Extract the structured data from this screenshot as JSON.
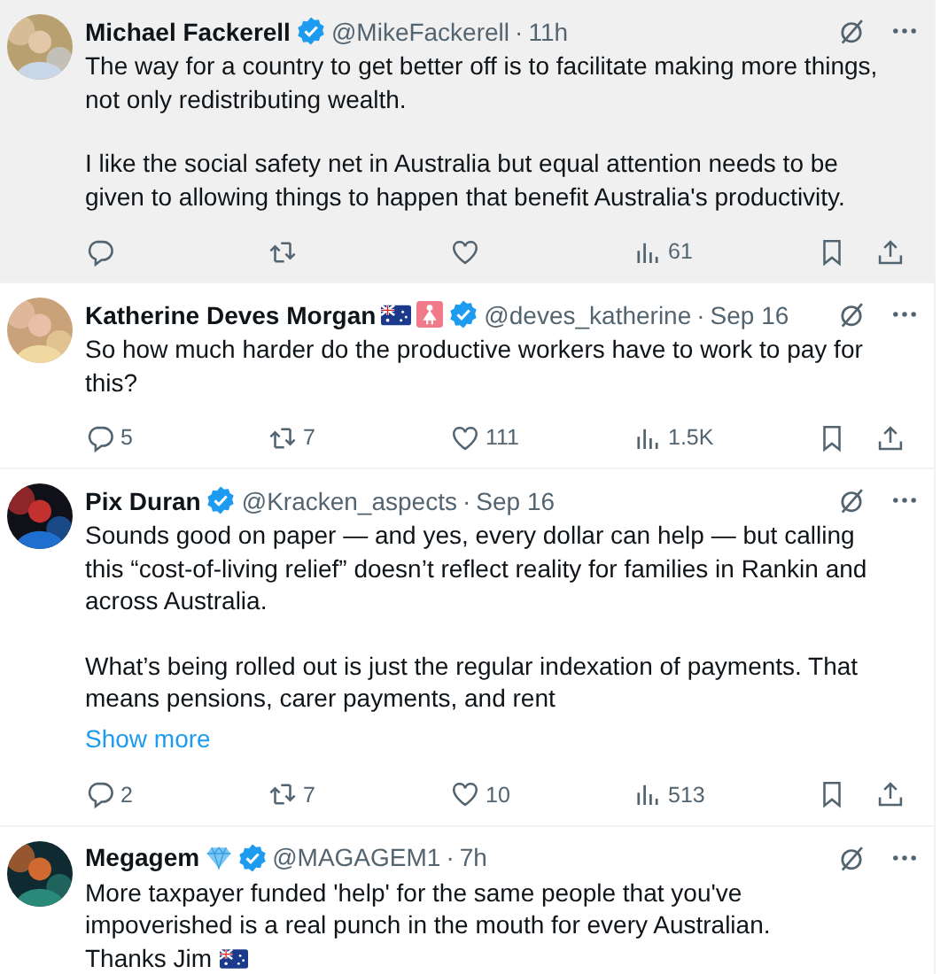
{
  "tweets": [
    {
      "name": "Michael Fackerell",
      "verified": true,
      "handle": "@MikeFackerell",
      "separator": "·",
      "time": "11h",
      "highlighted": true,
      "avatar": {
        "kind": "picture"
      },
      "paragraphs": [
        {
          "text": "The way for a country to get better off is to facilitate making more things, not only redistributing wealth."
        },
        {
          "text": "I like the social safety net in Australia but equal attention needs to be given to allowing things to happen that benefit Australia's productivity."
        }
      ],
      "stats": {
        "views": "61"
      }
    },
    {
      "name": "Katherine Deves Morgan",
      "badges": [
        {
          "kind": "flag"
        },
        {
          "kind": "female"
        }
      ],
      "verified": true,
      "handle": "@deves_katherine",
      "separator": "·",
      "time": "Sep 16",
      "highlighted": false,
      "avatar": {
        "kind": "picture"
      },
      "paragraphs": [
        {
          "text": "So how much harder do the productive workers have to work to pay for this?"
        }
      ],
      "stats": {
        "replies": "5",
        "reposts": "7",
        "likes": "111",
        "views": "1.5K"
      }
    },
    {
      "name": "Pix Duran",
      "verified": true,
      "handle": "@Kracken_aspects",
      "separator": "·",
      "time": "Sep 16",
      "highlighted": false,
      "avatar": {
        "kind": "picture"
      },
      "paragraphs": [
        {
          "text": "Sounds good on paper — and yes, every dollar can help — but calling this “cost-of-living relief” doesn’t reflect reality for families in Rankin and across Australia."
        },
        {
          "text": "What’s being rolled out is just the regular indexation of payments. That means pensions, carer payments, and rent"
        }
      ],
      "show_more": "Show more",
      "stats": {
        "replies": "2",
        "reposts": "7",
        "likes": "10",
        "views": "513"
      }
    },
    {
      "name": "Megagem",
      "badges": [
        {
          "kind": "diamond"
        }
      ],
      "verified": true,
      "handle": "@MAGAGEM1",
      "separator": "·",
      "time": "7h",
      "highlighted": false,
      "avatar": {
        "kind": "picture"
      },
      "paragraphs": [
        {
          "text": "More taxpayer funded 'help' for the same people that you've impoverished is a real punch in the mouth for every Australian.\nThanks Jim",
          "end_icon": {
            "kind": "flag"
          }
        }
      ]
    }
  ]
}
